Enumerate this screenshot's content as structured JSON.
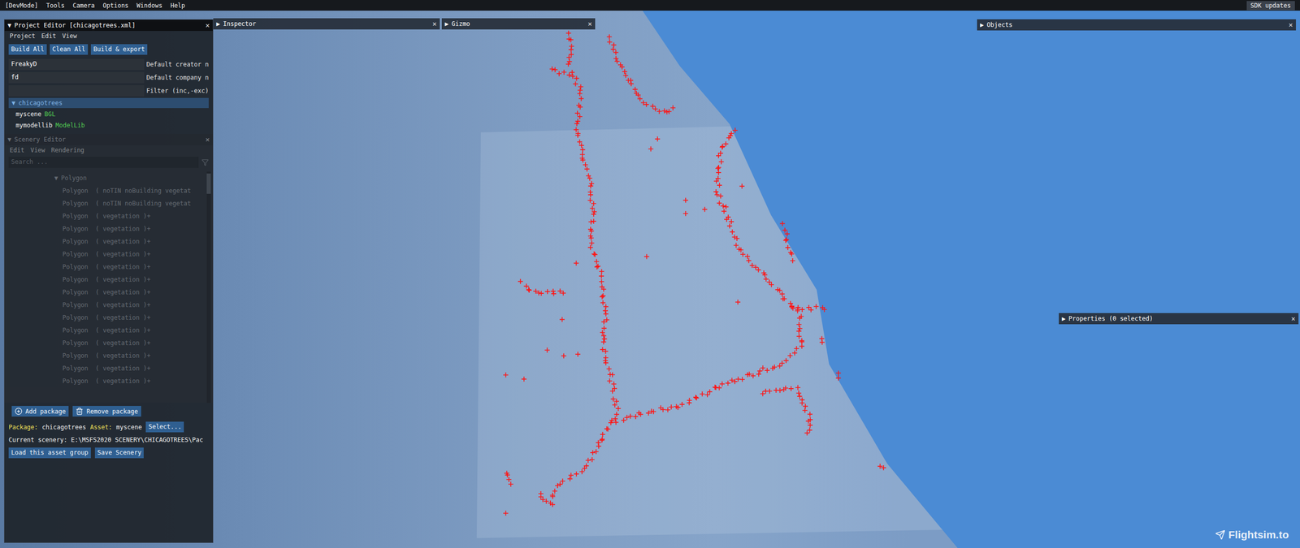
{
  "menu_bar": {
    "items": [
      "[DevMode]",
      "Tools",
      "Camera",
      "Options",
      "Windows",
      "Help"
    ],
    "right_button": "SDK updates"
  },
  "project_editor": {
    "title": "Project Editor [chicagotrees.xml]",
    "expander": "▼",
    "close": "×",
    "menu": [
      "Project",
      "Edit",
      "View"
    ],
    "buttons": [
      "Build All",
      "Clean All",
      "Build & export"
    ],
    "fields": [
      {
        "value": "FreakyD",
        "label": "Default creator n"
      },
      {
        "value": "fd",
        "label": "Default company n"
      },
      {
        "value": "",
        "label": "Filter (inc,-exc)"
      }
    ],
    "tree": [
      {
        "kind": "package",
        "expander": "▼",
        "label": "chicagotrees",
        "tag": "",
        "selected": true
      },
      {
        "kind": "asset",
        "expander": "",
        "label": "myscene",
        "tag": "BGL",
        "selected": false
      },
      {
        "kind": "asset",
        "expander": "",
        "label": "mymodellib",
        "tag": "ModelLib",
        "selected": false
      }
    ]
  },
  "scenery_editor": {
    "title": "Scenery Editor",
    "expander": "▼",
    "close": "×",
    "dimmed": true,
    "menu": [
      "Edit",
      "View",
      "Rendering"
    ],
    "search_placeholder": "Search ...",
    "group": {
      "expander": "▼",
      "label": "Polygon"
    },
    "rows": [
      "Polygon  ( noTIN noBuilding vegetat",
      "Polygon  ( noTIN noBuilding vegetat",
      "Polygon  ( vegetation )+",
      "Polygon  ( vegetation )+",
      "Polygon  ( vegetation )+",
      "Polygon  ( vegetation )+",
      "Polygon  ( vegetation )+",
      "Polygon  ( vegetation )+",
      "Polygon  ( vegetation )+",
      "Polygon  ( vegetation )+",
      "Polygon  ( vegetation )+",
      "Polygon  ( vegetation )+",
      "Polygon  ( vegetation )+",
      "Polygon  ( vegetation )+",
      "Polygon  ( vegetation )+",
      "Polygon  ( vegetation )+"
    ]
  },
  "package_buttons": [
    {
      "kind": "add",
      "label": "Add package"
    },
    {
      "kind": "remove",
      "label": "Remove package"
    }
  ],
  "footer": {
    "package_label": "Package:",
    "package": "chicagotrees",
    "asset_label": "Asset:",
    "asset": "myscene",
    "select_button": "Select...",
    "current_scenery": "Current scenery: E:\\MSFS2020 SCENERY\\CHICAGOTREES\\Pac",
    "buttons": [
      "Load this asset group",
      "Save Scenery"
    ]
  },
  "panels": [
    {
      "key": "inspector",
      "expander": "▶",
      "title": "Inspector",
      "close": "×"
    },
    {
      "key": "gizmo",
      "expander": "▶",
      "title": "Gizmo",
      "close": "×"
    },
    {
      "key": "objects",
      "expander": "▶",
      "title": "Objects",
      "close": "×"
    },
    {
      "key": "properties",
      "expander": "▶",
      "title": "Properties (0 selected)",
      "close": "×"
    }
  ],
  "watermark": "Flightsim.to"
}
